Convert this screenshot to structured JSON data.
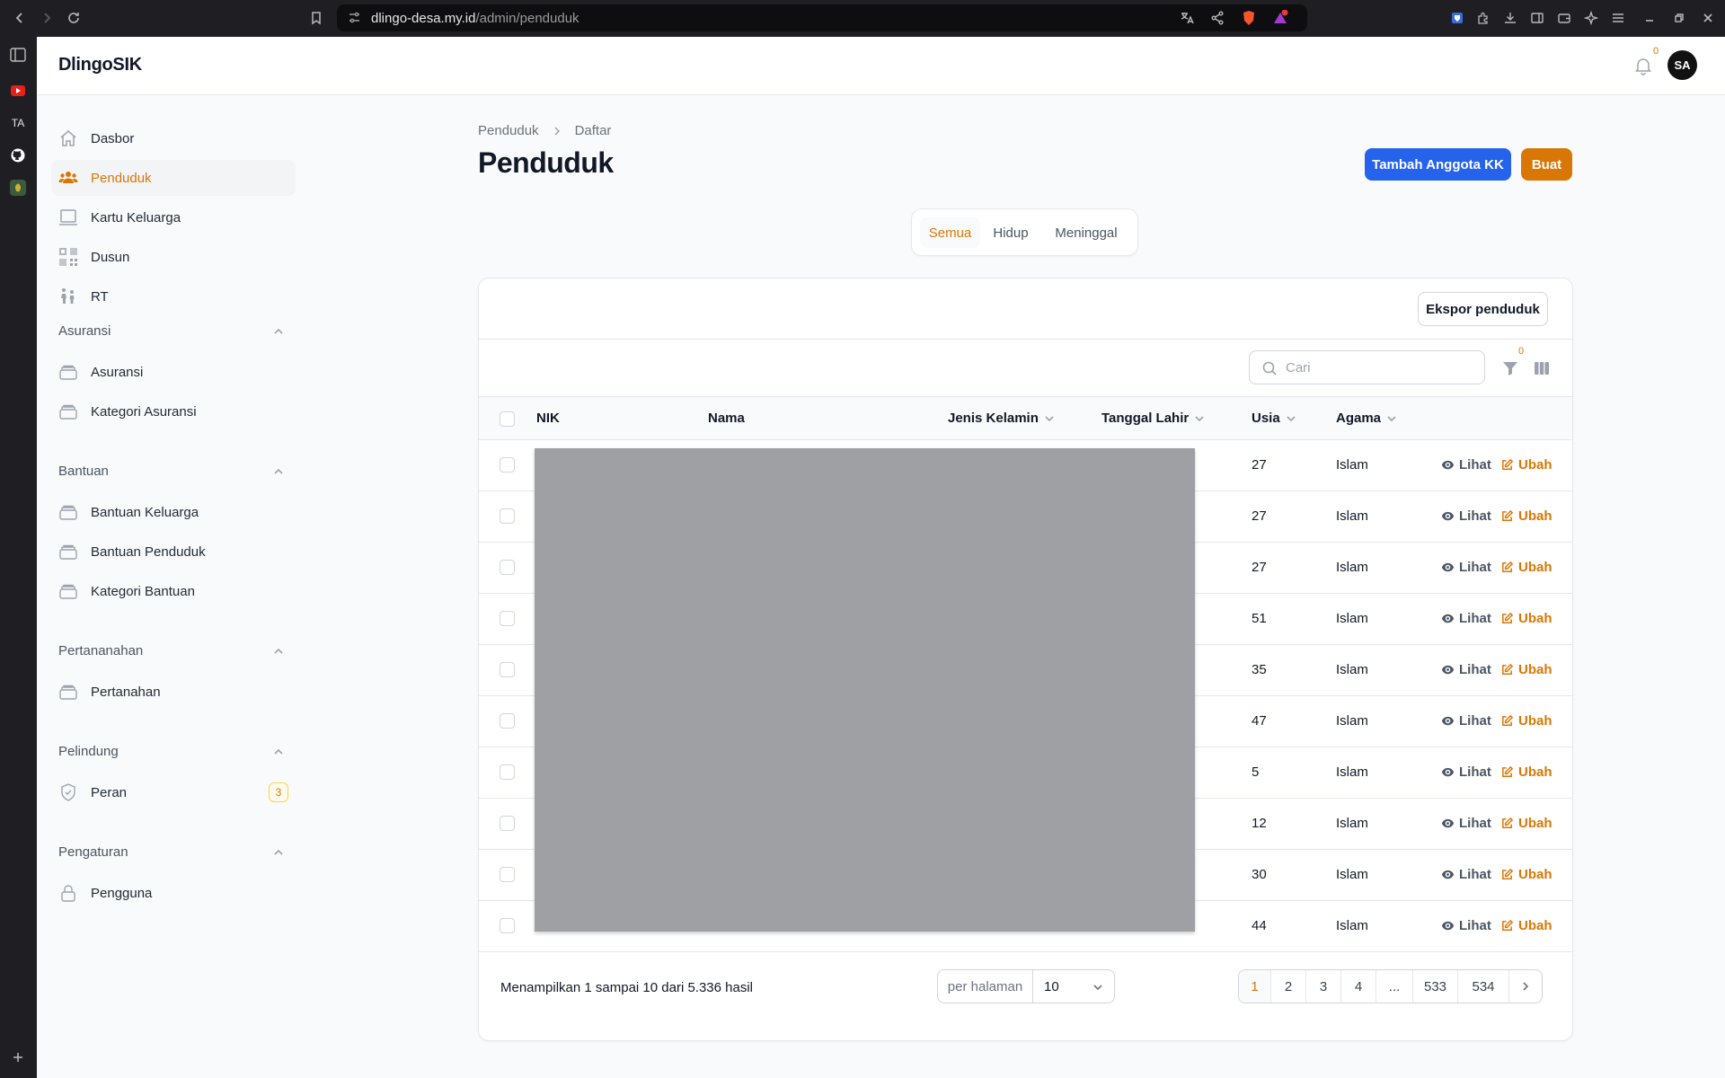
{
  "browser": {
    "url_host": "dlingo-desa.my.id",
    "url_path": "/admin/penduduk",
    "strip_ta": "TA"
  },
  "app": {
    "brand": "DlingoSIK",
    "notification_count": "0",
    "avatar_initials": "SA"
  },
  "sidebar": {
    "main_items": [
      {
        "label": "Dasbor",
        "icon": "home-icon"
      },
      {
        "label": "Penduduk",
        "icon": "users-icon"
      },
      {
        "label": "Kartu Keluarga",
        "icon": "laptop-icon"
      },
      {
        "label": "Dusun",
        "icon": "qr-icon"
      },
      {
        "label": "RT",
        "icon": "people-icon"
      }
    ],
    "groups": [
      {
        "label": "Asuransi",
        "items": [
          "Asuransi",
          "Kategori Asuransi"
        ]
      },
      {
        "label": "Bantuan",
        "items": [
          "Bantuan Keluarga",
          "Bantuan Penduduk",
          "Kategori Bantuan"
        ]
      },
      {
        "label": "Pertananahan",
        "items": [
          "Pertanahan"
        ]
      },
      {
        "label": "Pelindung",
        "items": [
          "Peran"
        ],
        "badge": "3"
      },
      {
        "label": "Pengaturan",
        "items": [
          "Pengguna"
        ]
      }
    ]
  },
  "main": {
    "breadcrumb": [
      "Penduduk",
      "Daftar"
    ],
    "title": "Penduduk",
    "add_family_member_button": "Tambah Anggota KK",
    "create_button": "Buat",
    "tabs": [
      "Semua",
      "Hidup",
      "Meninggal"
    ],
    "export_button": "Ekspor penduduk",
    "search_placeholder": "Cari",
    "filter_count": "0",
    "columns": [
      "NIK",
      "Nama",
      "Jenis Kelamin",
      "Tanggal Lahir",
      "Usia",
      "Agama"
    ],
    "rows": [
      {
        "usia": "27",
        "agama": "Islam"
      },
      {
        "usia": "27",
        "agama": "Islam"
      },
      {
        "usia": "27",
        "agama": "Islam"
      },
      {
        "usia": "51",
        "agama": "Islam"
      },
      {
        "usia": "35",
        "agama": "Islam"
      },
      {
        "usia": "47",
        "agama": "Islam"
      },
      {
        "usia": "5",
        "agama": "Islam"
      },
      {
        "usia": "12",
        "agama": "Islam"
      },
      {
        "usia": "30",
        "agama": "Islam"
      },
      {
        "usia": "44",
        "agama": "Islam"
      }
    ],
    "view_label": "Lihat",
    "edit_label": "Ubah",
    "footer_summary": "Menampilkan 1 sampai 10 dari 5.336 hasil",
    "per_page_label": "per halaman",
    "per_page_value": "10",
    "pages": [
      "1",
      "2",
      "3",
      "4",
      "...",
      "533",
      "534"
    ]
  },
  "colors": {
    "accent": "#d97706",
    "primary_blue": "#2563eb",
    "redaction": "#9fa0a3"
  }
}
